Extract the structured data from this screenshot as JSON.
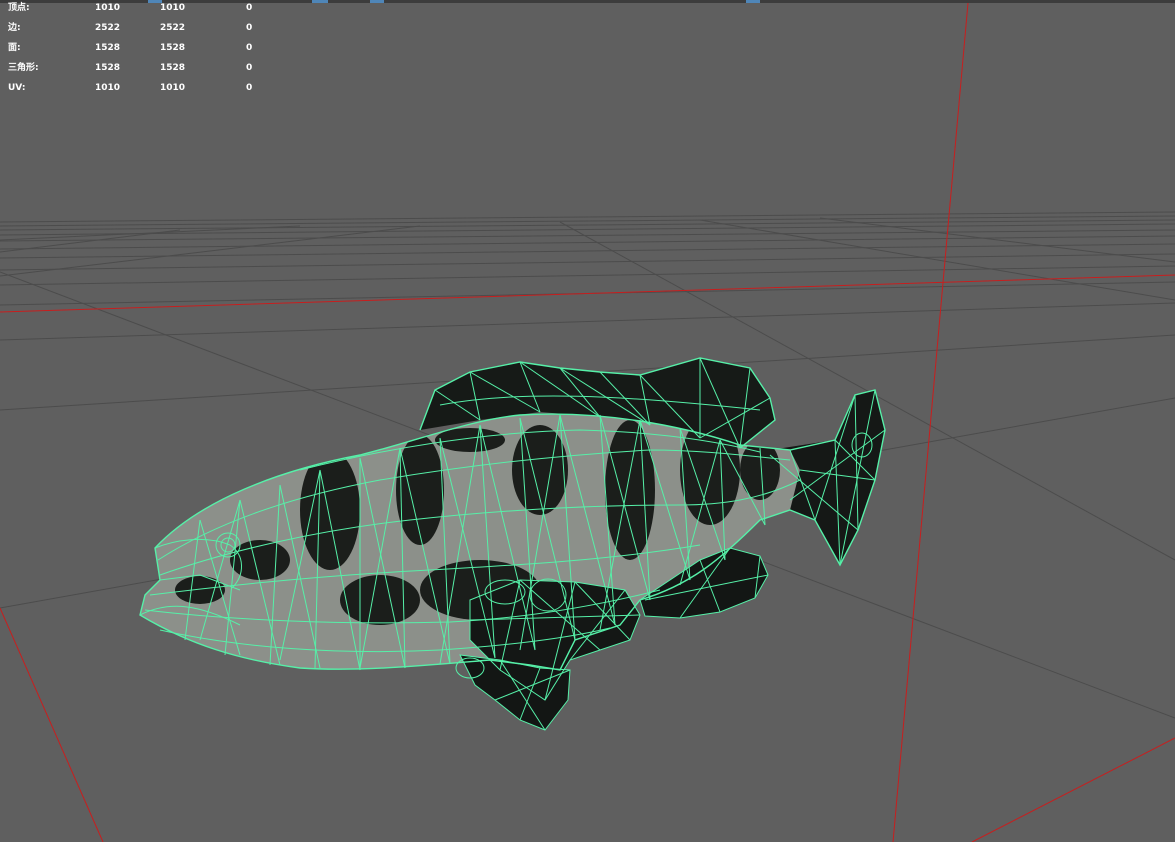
{
  "viewport": {
    "type": "3d-modeling-viewport",
    "background_color": "#5f5f5f",
    "grid_color": "#4c4c4c",
    "axis_color": "#c81e1e",
    "wireframe_color": "#56f0a8",
    "model": "grouper-fish-wireframe"
  },
  "poly_count": {
    "rows": [
      {
        "label": "顶点:",
        "v1": "1010",
        "v2": "1010",
        "v3": "0"
      },
      {
        "label": "边:",
        "v1": "2522",
        "v2": "2522",
        "v3": "0"
      },
      {
        "label": "面:",
        "v1": "1528",
        "v2": "1528",
        "v3": "0"
      },
      {
        "label": "三角形:",
        "v1": "1528",
        "v2": "1528",
        "v3": "0"
      },
      {
        "label": "UV:",
        "v1": "1010",
        "v2": "1010",
        "v3": "0"
      }
    ]
  }
}
